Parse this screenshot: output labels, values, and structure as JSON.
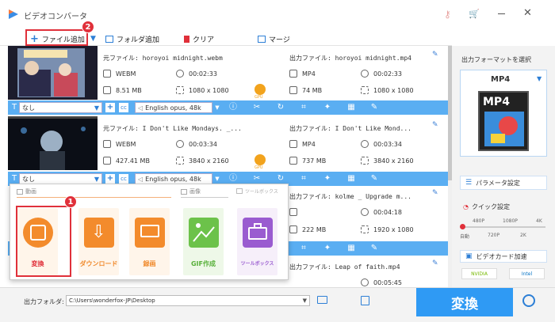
{
  "app": {
    "title": "ビデオコンバータ"
  },
  "toolbar": {
    "add_file": "ファイル追加",
    "add_folder": "フォルダ追加",
    "clear": "クリア",
    "merge": "マージ"
  },
  "badges": {
    "one": "1",
    "two": "2"
  },
  "files": [
    {
      "src_name": "元ファイル: horoyoi midnight.webm",
      "src_format": "WEBM",
      "src_duration": "00:02:33",
      "src_size": "8.51 MB",
      "src_res": "1080 x 1080",
      "out_name": "出力ファイル: horoyoi midnight.mp4",
      "out_format": "MP4",
      "out_duration": "00:02:33",
      "out_size": "74 MB",
      "out_res": "1080 x 1080",
      "subtitle": "なし",
      "audio": "English opus, 48k"
    },
    {
      "src_name": "元ファイル: I Don't Like Mondays. _...",
      "src_format": "WEBM",
      "src_duration": "00:03:34",
      "src_size": "427.41 MB",
      "src_res": "3840 x 2160",
      "out_name": "出力ファイル: I Don't Like Mond...",
      "out_format": "MP4",
      "out_duration": "00:03:34",
      "out_size": "737 MB",
      "out_res": "3840 x 2160",
      "subtitle": "なし",
      "audio": "English opus, 48k"
    },
    {
      "out_name": "出力ファイル: kolme _ Upgrade m...",
      "out_duration": "00:04:18",
      "out_size": "222 MB",
      "out_res": "1920 x 1080"
    },
    {
      "out_name": "出力ファイル: Leap of faith.mp4",
      "out_duration": "00:05:45"
    }
  ],
  "gpu": "GPU",
  "right": {
    "title": "出力フォーマットを選択",
    "format": "MP4",
    "format_big": "MP4",
    "params": "パラメータ設定",
    "quick": "クイック設定",
    "q_top": [
      "480P",
      "1080P",
      "4K"
    ],
    "q_bottom": [
      "自動",
      "720P",
      "2K"
    ],
    "accel": "ビデオカード加速",
    "nvidia": "NVIDIA",
    "intel": "Intel"
  },
  "bottom": {
    "folder_label": "出力フォルダ:",
    "folder_path": "C:\\Users\\wonderfox-JP\\Desktop",
    "convert": "変換"
  },
  "popup": {
    "sections": [
      "動画",
      "画像",
      "ツールボックス"
    ],
    "tiles": [
      "変換",
      "ダウンロード",
      "録画",
      "GIF作成",
      "ツールボックス"
    ]
  }
}
